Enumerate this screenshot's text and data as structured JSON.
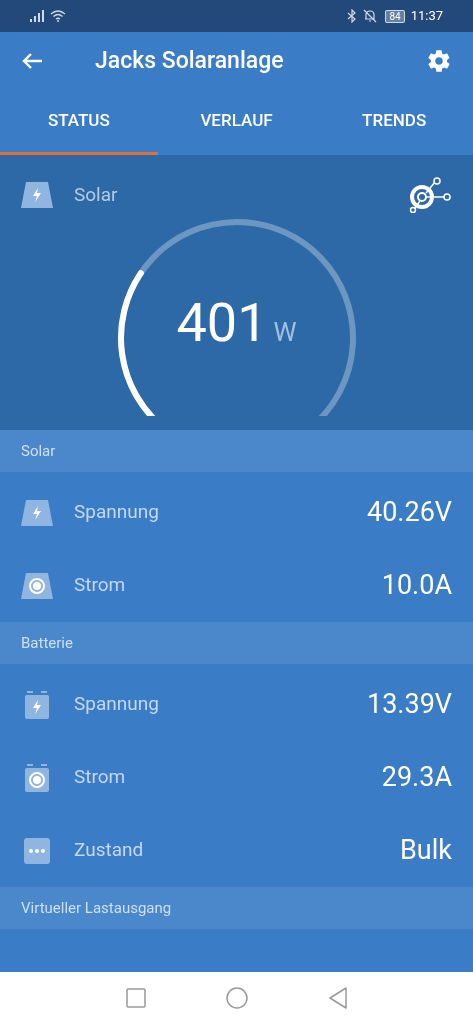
{
  "status_bar": {
    "battery": "84",
    "time": "11:37"
  },
  "header": {
    "title": "Jacks Solaranlage"
  },
  "tabs": [
    {
      "label": "STATUS",
      "selected": true
    },
    {
      "label": "VERLAUF",
      "selected": false
    },
    {
      "label": "TRENDS",
      "selected": false
    }
  ],
  "gauge": {
    "label": "Solar",
    "value": "401",
    "unit": "W"
  },
  "sections": [
    {
      "title": "Solar",
      "rows": [
        {
          "kind": "panel-bolt",
          "label": "Spannung",
          "value": "40.26V"
        },
        {
          "kind": "panel-dot",
          "label": "Strom",
          "value": "10.0A"
        }
      ]
    },
    {
      "title": "Batterie",
      "rows": [
        {
          "kind": "battery-bolt",
          "label": "Spannung",
          "value": "13.39V"
        },
        {
          "kind": "battery-dot",
          "label": "Strom",
          "value": "29.3A"
        },
        {
          "kind": "dots",
          "label": "Zustand",
          "value": "Bulk"
        }
      ]
    },
    {
      "title": "Virtueller Lastausgang"
    }
  ]
}
